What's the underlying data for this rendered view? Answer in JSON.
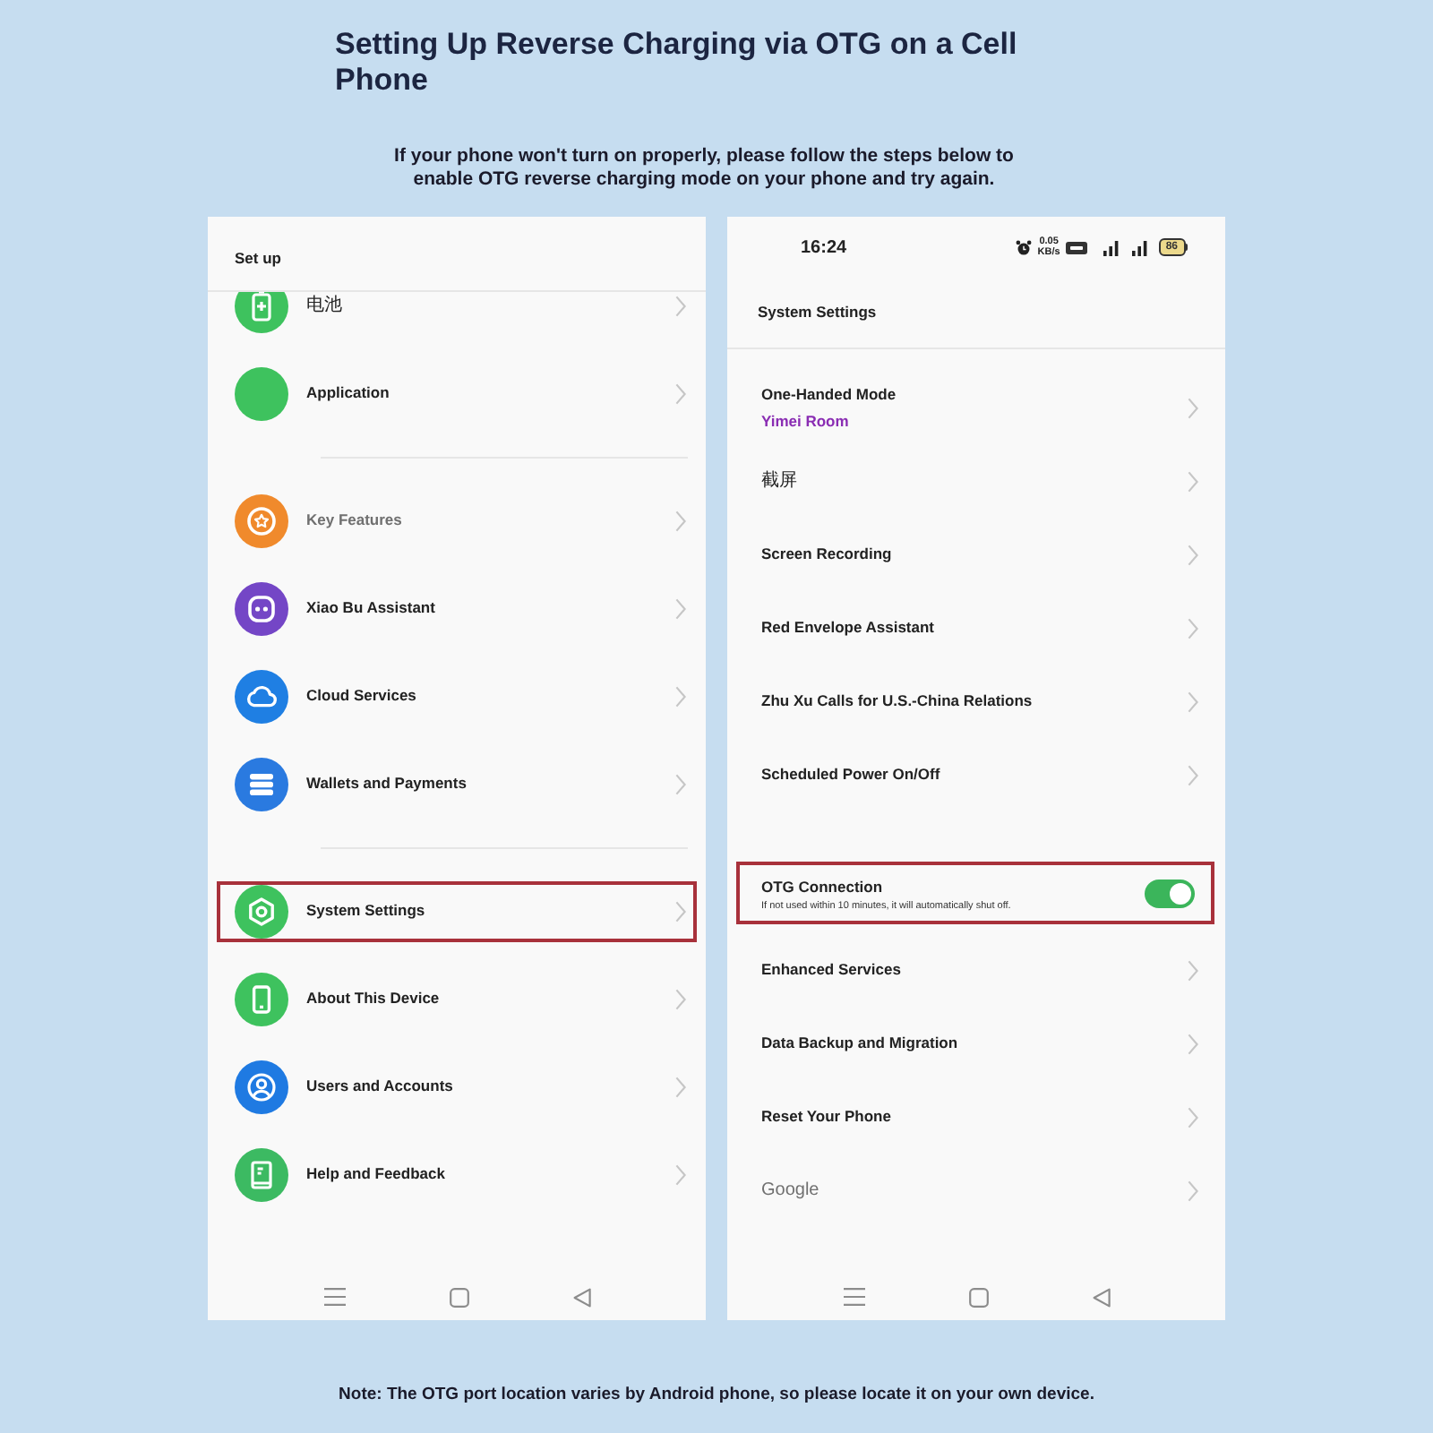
{
  "page": {
    "title": "Setting Up Reverse Charging via OTG on a Cell Phone",
    "intro": "If your phone won't turn on properly, please follow the steps below to enable OTG reverse charging mode on your phone and try again.",
    "note": "Note: The OTG port location varies by Android phone, so please locate it on your own device."
  },
  "left_phone": {
    "header": "Set up",
    "sections": [
      {
        "items": [
          {
            "label": "电池",
            "color": "#3ec25e",
            "bold": false,
            "muted": false,
            "highlighted": false
          },
          {
            "label": "Application",
            "color": "#3ec25e",
            "bold": true,
            "muted": false,
            "highlighted": false
          }
        ]
      },
      {
        "items": [
          {
            "label": "Key Features",
            "color": "#f08a2c",
            "bold": true,
            "muted": true,
            "highlighted": false
          },
          {
            "label": "Xiao Bu Assistant",
            "color": "#7446c6",
            "bold": true,
            "muted": false,
            "highlighted": false
          },
          {
            "label": "Cloud Services",
            "color": "#1f7fe3",
            "bold": true,
            "muted": false,
            "highlighted": false
          },
          {
            "label": "Wallets and Payments",
            "color": "#2a7ae0",
            "bold": true,
            "muted": false,
            "highlighted": false
          }
        ]
      },
      {
        "items": [
          {
            "label": "System Settings",
            "color": "#3ec25e",
            "bold": true,
            "muted": false,
            "highlighted": true
          },
          {
            "label": "About This Device",
            "color": "#3ec25e",
            "bold": true,
            "muted": false,
            "highlighted": false
          },
          {
            "label": "Users and Accounts",
            "color": "#1f7ae2",
            "bold": true,
            "muted": false,
            "highlighted": false
          },
          {
            "label": "Help and Feedback",
            "color": "#3cba62",
            "bold": true,
            "muted": false,
            "highlighted": false
          }
        ]
      }
    ]
  },
  "right_phone": {
    "status_bar": {
      "time": "16:24",
      "net_speed": [
        "0.05",
        "KB/s"
      ],
      "battery": "86"
    },
    "header": "System Settings",
    "sections": [
      {
        "items": [
          {
            "kind": "link",
            "label": "One-Handed Mode",
            "value": "Yimei Room",
            "bold": true,
            "muted": false,
            "highlighted": false
          },
          {
            "kind": "link",
            "label": "截屏",
            "bold": false,
            "muted": false,
            "highlighted": false
          },
          {
            "kind": "link",
            "label": "Screen Recording",
            "bold": true,
            "muted": false,
            "highlighted": false
          },
          {
            "kind": "link",
            "label": "Red Envelope Assistant",
            "bold": true,
            "muted": false,
            "highlighted": false
          },
          {
            "kind": "link",
            "label": "Zhu Xu Calls for U.S.-China Relations",
            "bold": true,
            "muted": false,
            "highlighted": false
          },
          {
            "kind": "link",
            "label": "Scheduled Power On/Off",
            "bold": true,
            "muted": false,
            "highlighted": false
          }
        ]
      },
      {
        "items": [
          {
            "kind": "toggle",
            "label": "OTG Connection",
            "description": "If not used within 10 minutes, it will automatically shut off.",
            "on": true,
            "bold": true,
            "muted": false,
            "highlighted": true
          },
          {
            "kind": "link",
            "label": "Enhanced Services",
            "bold": true,
            "muted": false,
            "highlighted": false
          },
          {
            "kind": "link",
            "label": "Data Backup and Migration",
            "bold": true,
            "muted": false,
            "highlighted": false
          },
          {
            "kind": "link",
            "label": "Reset Your Phone",
            "bold": true,
            "muted": false,
            "highlighted": false
          },
          {
            "kind": "link",
            "label": "Google",
            "bold": false,
            "muted": true,
            "highlighted": false
          }
        ]
      }
    ]
  }
}
